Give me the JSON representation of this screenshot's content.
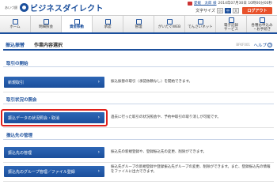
{
  "header": {
    "logo_small": "あいづ銀",
    "logo_text": "ビジネスダイレクト",
    "user_name": "愛媛　太郎 様",
    "last_login": "2014年07月30日 10時00分00秒",
    "font_size_label": "文字サイズ",
    "font_sizes": [
      "小",
      "中",
      "大"
    ],
    "logout_label": "ログアウト"
  },
  "gnav": [
    {
      "label": "ホーム"
    },
    {
      "label": "明細照会"
    },
    {
      "label": "資金移動"
    },
    {
      "label": "承認"
    },
    {
      "label": "管理"
    },
    {
      "label": "がいたぐWEB"
    },
    {
      "label": "でんさいネット"
    },
    {
      "label": "電子記録\nサービス"
    },
    {
      "label": "各種お申込み\n・お手続き"
    }
  ],
  "title": {
    "main": "振込振替",
    "sub": "作業内容選択",
    "screen_id": "BFKF001",
    "help_label": "ヘルプ"
  },
  "sections": [
    {
      "title": "取引の開始",
      "items": [
        {
          "label": "新規取引",
          "desc": "振込振替の取引（承認依頼なし）を開始できます。"
        }
      ]
    },
    {
      "title": "取引状況の照会",
      "items": [
        {
          "label": "振込データの状況照会・取消",
          "desc": "過去に行った取引の状況照会や、予約中取引の取り消しが可能です。"
        }
      ]
    },
    {
      "title": "振込先の管理",
      "items": [
        {
          "label": "振込先の管理",
          "desc": "振込先の新規登録や、登録振込先の変更、削除ができます。"
        },
        {
          "label": "振込先のグループ管理／ファイル登録",
          "desc": "振込先グループの新規登録や登録振込先グループの変更、削除ができます。また、登録振込先の情報をファイルに出力できます。"
        }
      ]
    }
  ]
}
